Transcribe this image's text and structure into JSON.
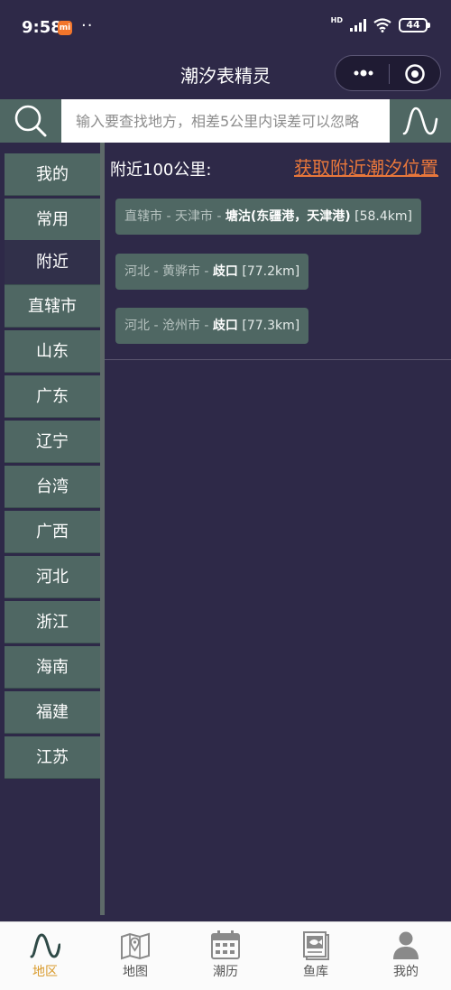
{
  "status": {
    "time": "9:58",
    "mi_badge": "mi",
    "dots": "··",
    "hd": "HD",
    "battery": "44"
  },
  "header": {
    "title": "潮汐表精灵"
  },
  "search": {
    "placeholder": "输入要查找地方，相差5公里内误差可以忽略"
  },
  "sidebar": {
    "items": [
      {
        "label": "我的"
      },
      {
        "label": "常用"
      },
      {
        "label": "附近",
        "active": true
      },
      {
        "label": "直辖市"
      },
      {
        "label": "山东"
      },
      {
        "label": "广东"
      },
      {
        "label": "辽宁"
      },
      {
        "label": "台湾"
      },
      {
        "label": "广西"
      },
      {
        "label": "河北"
      },
      {
        "label": "浙江"
      },
      {
        "label": "海南"
      },
      {
        "label": "福建"
      },
      {
        "label": "江苏"
      }
    ]
  },
  "main": {
    "nearby_title": "附近100公里:",
    "locate_link": "获取附近潮汐位置",
    "results": [
      {
        "region": "直辖市 - 天津市 - ",
        "name": "塘沽(东疆港，天津港)",
        "distance": " [58.4km]"
      },
      {
        "region": "河北 - 黄骅市 - ",
        "name": "歧口",
        "distance": " [77.2km]"
      },
      {
        "region": "河北 - 沧州市 - ",
        "name": "歧口",
        "distance": " [77.3km]"
      }
    ]
  },
  "tabbar": {
    "tabs": [
      {
        "label": "地区",
        "icon": "wave-icon",
        "active": true
      },
      {
        "label": "地图",
        "icon": "map-icon"
      },
      {
        "label": "潮历",
        "icon": "calendar-icon"
      },
      {
        "label": "鱼库",
        "icon": "fish-book-icon"
      },
      {
        "label": "我的",
        "icon": "user-icon"
      }
    ]
  },
  "colors": {
    "background": "#2e2948",
    "panel": "#4f6763",
    "accent_link": "#e8773b",
    "active_tab": "#d99a2b"
  }
}
